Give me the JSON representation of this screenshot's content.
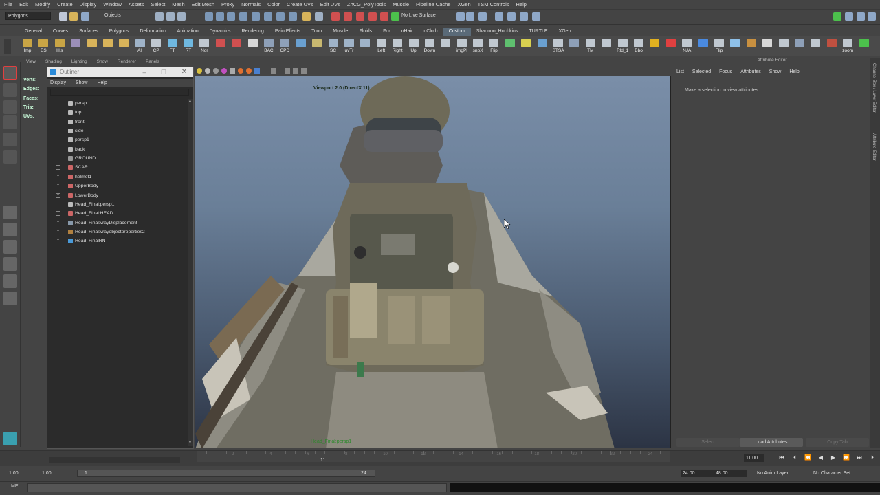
{
  "menubar": [
    "File",
    "Edit",
    "Modify",
    "Create",
    "Display",
    "Window",
    "Assets",
    "Select",
    "Mesh",
    "Edit Mesh",
    "Proxy",
    "Normals",
    "Color",
    "Create UVs",
    "Edit UVs",
    "ZhCG_PolyTools",
    "Muscle",
    "Pipeline Cache",
    "XGen",
    "TSM Controls",
    "Help"
  ],
  "statusline": {
    "mode": "Polygons",
    "objects_field": "Objects",
    "live_surface": "No Live Surface"
  },
  "shelf_tabs": [
    "General",
    "Curves",
    "Surfaces",
    "Polygons",
    "Deformation",
    "Animation",
    "Dynamics",
    "Rendering",
    "PaintEffects",
    "Toon",
    "Muscle",
    "Fluids",
    "Fur",
    "nHair",
    "nCloth",
    "Custom",
    "Shannon_Hochkins",
    "TURTLE",
    "XGen"
  ],
  "active_shelf_tab": "Custom",
  "shelf_buttons": [
    {
      "label": "Imp",
      "color": "#c9a545"
    },
    {
      "label": "ES",
      "color": "#c9a545"
    },
    {
      "label": "His",
      "color": "#c9a545"
    },
    {
      "label": "",
      "color": "#9b8fb8"
    },
    {
      "label": "",
      "color": "#d8b35a"
    },
    {
      "label": "",
      "color": "#d8b35a"
    },
    {
      "label": "",
      "color": "#d8b35a"
    },
    {
      "label": "All",
      "color": "#9fb3c8"
    },
    {
      "label": "CP",
      "color": "#c0c8d0"
    },
    {
      "label": "FT",
      "color": "#6fb8e0"
    },
    {
      "label": "RT",
      "color": "#6fb8e0"
    },
    {
      "label": "Nor",
      "color": "#c0c8d0"
    },
    {
      "label": "",
      "color": "#d05050"
    },
    {
      "label": "",
      "color": "#d05050"
    },
    {
      "label": "",
      "color": "#d8d8d8"
    },
    {
      "label": "BAC",
      "color": "#8ea0b8"
    },
    {
      "label": "CPD",
      "color": "#8ea0b8"
    },
    {
      "label": "",
      "color": "#6aa0d0"
    },
    {
      "label": "",
      "color": "#c8b870"
    },
    {
      "label": "SC",
      "color": "#9fb3c8"
    },
    {
      "label": "uvTr",
      "color": "#9fb3c8"
    },
    {
      "label": "",
      "color": "#9fb3c8"
    },
    {
      "label": "Left",
      "color": "#c0c8d0"
    },
    {
      "label": "Right",
      "color": "#c0c8d0"
    },
    {
      "label": "Up",
      "color": "#c0c8d0"
    },
    {
      "label": "Down",
      "color": "#c0c8d0"
    },
    {
      "label": "",
      "color": "#c0c8d0"
    },
    {
      "label": "imgPl",
      "color": "#c0c8d0"
    },
    {
      "label": "snpX",
      "color": "#c0c8d0"
    },
    {
      "label": "Flip",
      "color": "#c0c8d0"
    },
    {
      "label": "",
      "color": "#5fc06f"
    },
    {
      "label": "",
      "color": "#d8d050"
    },
    {
      "label": "",
      "color": "#6aa0d0"
    },
    {
      "label": "STSA",
      "color": "#c0c8d0"
    },
    {
      "label": "",
      "color": "#8ea0b8"
    },
    {
      "label": "TM",
      "color": "#c0c8d0"
    },
    {
      "label": "",
      "color": "#c0c8d0"
    },
    {
      "label": "Rld_1",
      "color": "#c0c8d0"
    },
    {
      "label": "Bbo",
      "color": "#c0c8d0"
    },
    {
      "label": "",
      "color": "#e0b020"
    },
    {
      "label": "",
      "color": "#e04040"
    },
    {
      "label": "NJA",
      "color": "#c0c8d0"
    },
    {
      "label": "",
      "color": "#4a8ae0"
    },
    {
      "label": "Flip",
      "color": "#c0c8d0"
    },
    {
      "label": "",
      "color": "#8ec0e8"
    },
    {
      "label": "",
      "color": "#c89040"
    },
    {
      "label": "",
      "color": "#d8d8d8"
    },
    {
      "label": "",
      "color": "#c0c8d0"
    },
    {
      "label": "",
      "color": "#8ea0b8"
    },
    {
      "label": "",
      "color": "#c0c8d0"
    },
    {
      "label": "",
      "color": "#c05040"
    },
    {
      "label": "zoom",
      "color": "#c0c8d0"
    },
    {
      "label": "",
      "color": "#4cc04c"
    }
  ],
  "viewport_menu": [
    "View",
    "Shading",
    "Lighting",
    "Show",
    "Renderer",
    "Panels"
  ],
  "viewport": {
    "label": "Viewport 2.0 (DirectX 11)",
    "camera_label": "Head_Final:persp1"
  },
  "hud": [
    "Verts:",
    "Edges:",
    "Faces:",
    "Tris:",
    "UVs:"
  ],
  "outliner": {
    "title": "Outliner",
    "menu": [
      "Display",
      "Show",
      "Help"
    ],
    "items": [
      {
        "label": "persp",
        "indent": 1,
        "expand": false,
        "icon": "camera-icon",
        "color": "#bbb"
      },
      {
        "label": "top",
        "indent": 1,
        "expand": false,
        "icon": "camera-icon",
        "color": "#bbb"
      },
      {
        "label": "front",
        "indent": 1,
        "expand": false,
        "icon": "camera-icon",
        "color": "#bbb"
      },
      {
        "label": "side",
        "indent": 1,
        "expand": false,
        "icon": "camera-icon",
        "color": "#bbb"
      },
      {
        "label": "persp1",
        "indent": 1,
        "expand": false,
        "icon": "camera-icon",
        "color": "#bbb"
      },
      {
        "label": "back",
        "indent": 1,
        "expand": false,
        "icon": "camera-icon",
        "color": "#bbb"
      },
      {
        "label": "GROUND",
        "indent": 1,
        "expand": false,
        "icon": "transform-icon",
        "color": "#999"
      },
      {
        "label": "SCAR",
        "indent": 1,
        "expand": true,
        "icon": "mesh-icon",
        "color": "#c66"
      },
      {
        "label": "helmet1",
        "indent": 1,
        "expand": true,
        "icon": "mesh-icon",
        "color": "#c66"
      },
      {
        "label": "UpperBody",
        "indent": 1,
        "expand": true,
        "icon": "mesh-icon",
        "color": "#c66"
      },
      {
        "label": "LowerBody",
        "indent": 1,
        "expand": true,
        "icon": "mesh-icon",
        "color": "#c66"
      },
      {
        "label": "Head_Final:persp1",
        "indent": 1,
        "expand": false,
        "icon": "camera-icon",
        "color": "#bbb"
      },
      {
        "label": "Head_Final:HEAD",
        "indent": 1,
        "expand": true,
        "icon": "mesh-icon",
        "color": "#c66"
      },
      {
        "label": "Head_Final:vrayDisplacement",
        "indent": 1,
        "expand": true,
        "icon": "sphere-icon",
        "color": "#8899aa"
      },
      {
        "label": "Head_Final:vrayobjectproperties2",
        "indent": 1,
        "expand": true,
        "icon": "properties-icon",
        "color": "#b08040"
      },
      {
        "label": "Head_FinalRN",
        "indent": 1,
        "expand": true,
        "icon": "reference-icon",
        "color": "#4a9ad8"
      }
    ]
  },
  "attribute_editor": {
    "title": "Attribute Editor",
    "menu": [
      "List",
      "Selected",
      "Focus",
      "Attributes",
      "Show",
      "Help"
    ],
    "message": "Make a selection to view attributes",
    "select_button": "Select",
    "load_button": "Load Attributes",
    "copy_button": "Copy Tab"
  },
  "right_strip": [
    "Channel Box / Layer Editor",
    "Attribute Editor"
  ],
  "timeline": {
    "ticks": [
      "2",
      "4",
      "6",
      "8",
      "10",
      "12",
      "14",
      "16",
      "18",
      "20",
      "22",
      "24"
    ],
    "current_frame_marker": "11",
    "current_frame": "11.00"
  },
  "range": {
    "start_time": "1.00",
    "start_range": "1.00",
    "slider_start": "1",
    "slider_end": "24",
    "end_range": "24.00",
    "end_time": "48.00",
    "anim_layer": "No Anim Layer",
    "char_set": "No Character Set"
  },
  "cmdline": {
    "label": "MEL"
  }
}
